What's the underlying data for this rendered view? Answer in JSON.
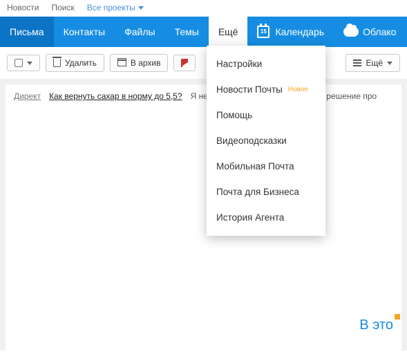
{
  "topbar": {
    "news": "Новости",
    "search": "Поиск",
    "projects": "Все проекты"
  },
  "nav": {
    "mail": "Письма",
    "contacts": "Контакты",
    "files": "Файлы",
    "themes": "Темы",
    "more": "Ещё",
    "calendar": "Календарь",
    "calendar_day": "15",
    "cloud": "Облако"
  },
  "toolbar": {
    "delete": "Удалить",
    "archive": "В архив",
    "more": "Ещё"
  },
  "dropdown": {
    "settings": "Настройки",
    "mailnews": "Новости Почты",
    "mailnews_badge": "Новое",
    "help": "Помощь",
    "videotips": "Видеоподсказки",
    "mobile": "Мобильная Почта",
    "business": "Почта для Бизнеса",
    "agent": "История Агента"
  },
  "promo": {
    "direkt": "Директ",
    "question": "Как вернуть сахар в норму до 5,5?",
    "lead": "Я не",
    "tail": "т оно - решение про"
  },
  "footer": {
    "text": "В это"
  }
}
